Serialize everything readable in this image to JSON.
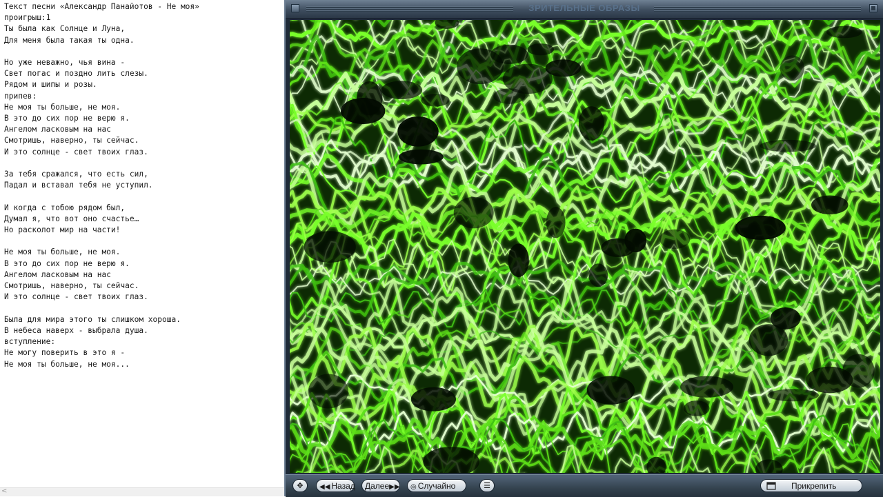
{
  "editor": {
    "lines": [
      "Текст песни «Александр Панайотов - Не моя»",
      "проигрыш:1",
      "Ты была как Солнце и Луна,",
      "Для меня была такая ты одна.",
      "",
      "Но уже неважно, чья вина -",
      "Свет погас и поздно лить слезы.",
      "Рядом и шипы и розы.",
      "припев:",
      "Не моя ты больше, не моя.",
      "В это до сих пор не верю я.",
      "Ангелом ласковым на нас",
      "Смотришь, наверно, ты сейчас.",
      "И это солнце - свет твоих глаз.",
      "",
      "За тебя сражался, что есть сил,",
      "Падал и вставал тебя не уступил.",
      "",
      "И когда с тобою рядом был,",
      "Думал я, что вот оно счастье…",
      "Но расколот мир на части!",
      "",
      "Не моя ты больше, не моя.",
      "В это до сих пор не верю я.",
      "Ангелом ласковым на нас",
      "Смотришь, наверно, ты сейчас.",
      "И это солнце - свет твоих глаз.",
      "",
      "Была для мира этого ты слишком хороша.",
      "В небеса наверх - выбрала душа.",
      "вступление:",
      "Не могу поверить в это я -",
      "Не моя ты больше, не моя..."
    ],
    "scroll_left_glyph": "<"
  },
  "visualizer": {
    "title": "ЗРИТЕЛЬНЫЕ ОБРАЗЫ",
    "accent": "#79ff2a",
    "controls": {
      "nav_glyph": "✥",
      "back_glyph": "◀◀",
      "back_label": "Назад",
      "next_label": "Далее",
      "next_glyph": "▶▶",
      "random_glyph": "◎",
      "random_label": "Случайно",
      "list_glyph": "☰",
      "attach_icon": "pin-window-icon",
      "attach_label": "Прикрепить"
    }
  }
}
